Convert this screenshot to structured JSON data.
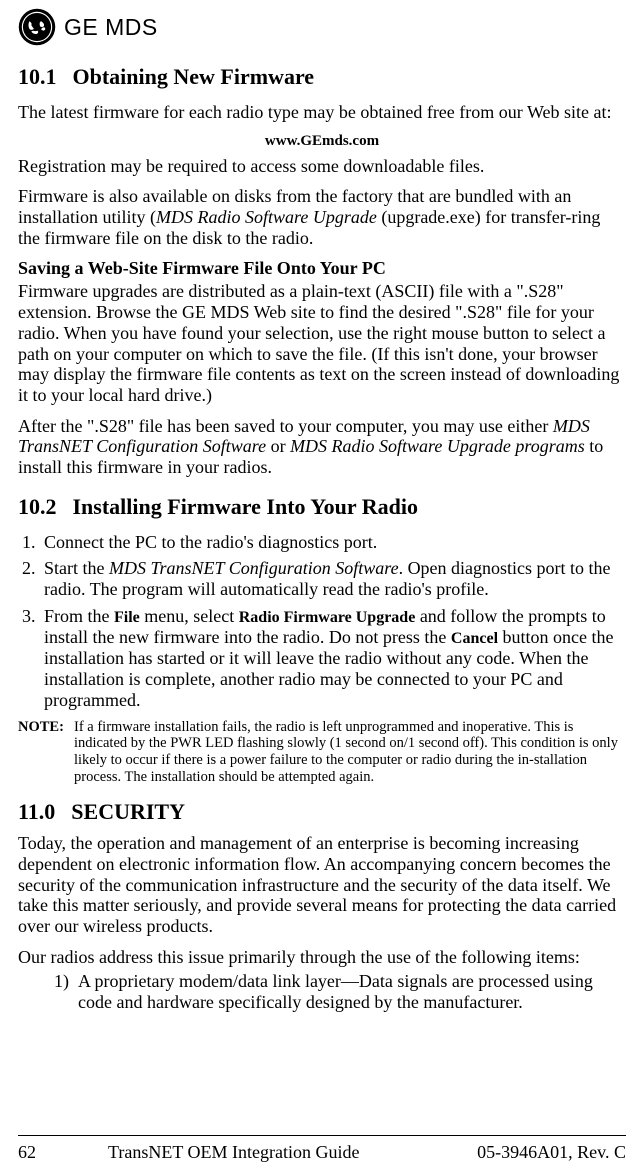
{
  "logo": {
    "brand": "GE MDS"
  },
  "s10_1": {
    "num": "10.1",
    "title": "Obtaining New Firmware",
    "p1": "The latest firmware for each radio type may be obtained free from our Web site at:",
    "url": "www.GEmds.com",
    "p2": "Registration may be required to access some downloadable files.",
    "p3a": "Firmware is also available on disks from the factory that are bundled with an installation utility (",
    "p3b_ital": "MDS Radio Software Upgrade",
    "p3c": " (upgrade.exe) for transfer-ring the firmware file on the disk to the radio.",
    "sub1": "Saving a Web-Site Firmware File Onto Your PC",
    "p4": "Firmware upgrades are distributed as a plain-text (ASCII) file with a \".S28\" extension. Browse the GE MDS Web site to find the desired \".S28\" file for your radio. When you have found your selection, use the right mouse button to select a path on your computer on which to save the file. (If this isn't done, your browser may display the firmware file contents as text on the screen instead of downloading it to your local hard drive.)",
    "p5a": "After the \".S28\" file has been saved to your computer, you may use either ",
    "p5b_ital": "MDS TransNET Configuration Software",
    "p5c": " or ",
    "p5d_ital": "MDS Radio Software Upgrade programs",
    "p5e": " to install this firmware in your radios."
  },
  "s10_2": {
    "num": "10.2",
    "title": "Installing Firmware Into Your Radio",
    "li1": "Connect the PC to the radio's diagnostics port.",
    "li2a": "Start the ",
    "li2b_ital": "MDS TransNET Configuration Software",
    "li2c": ". Open diagnostics port to the radio. The program will automatically read the radio's profile.",
    "li3a": "From the ",
    "li3_file": "File",
    "li3b": " menu, select ",
    "li3_rfu": "Radio Firmware Upgrade",
    "li3c": " and follow the prompts to install the new firmware into the radio. Do not press the ",
    "li3_cancel": "Cancel",
    "li3d": " button once the installation has started or it will leave the radio without any code. When the installation is complete, another radio may be connected to your PC and programmed.",
    "note_label": "NOTE:",
    "note_text": "If a firmware installation fails, the radio is left unprogrammed and inoperative. This is indicated by the PWR LED flashing slowly (1 second on/1 second off). This condition is only likely to occur if there is a power failure to the computer or radio during the in-stallation process. The installation should be attempted again."
  },
  "s11": {
    "num": "11.0",
    "title": "SECURITY",
    "p1": "Today, the operation and management of an enterprise is becoming increasing dependent on electronic information flow. An accompanying concern becomes the security of the communication infrastructure and the security of the data itself. We take this matter seriously, and provide several means for protecting the data carried over our wireless products.",
    "p2": "Our radios address this issue primarily through the use of the following items:",
    "li1_num": "1)",
    "li1": "A proprietary modem/data link layer—Data signals are processed using code and hardware specifically designed by the manufacturer."
  },
  "footer": {
    "page": "62",
    "title": "TransNET OEM Integration Guide",
    "rev": "05-3946A01, Rev. C"
  }
}
